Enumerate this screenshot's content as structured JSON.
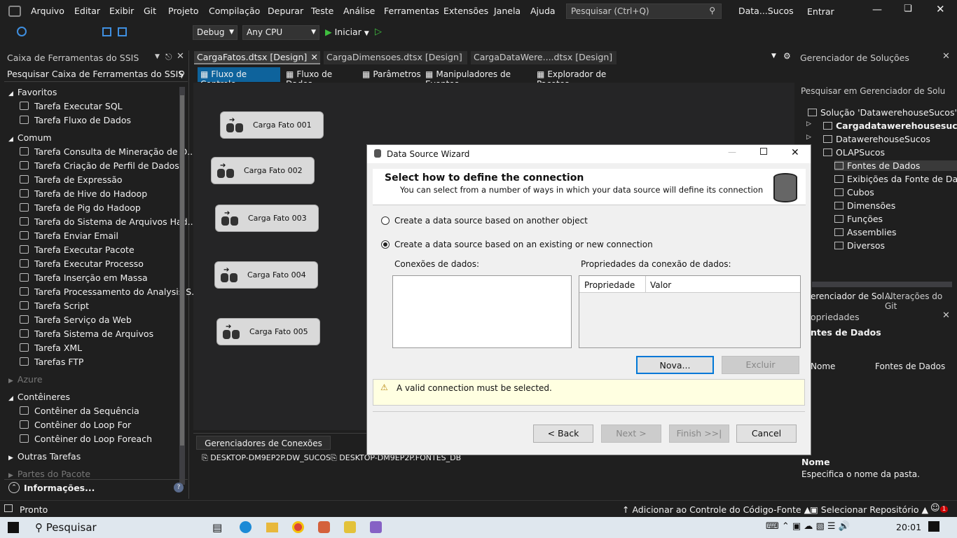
{
  "menu": {
    "items": [
      "Arquivo",
      "Editar",
      "Exibir",
      "Git",
      "Projeto",
      "Compilação",
      "Depurar",
      "Teste",
      "Análise",
      "Ferramentas",
      "Extensões",
      "Janela",
      "Ajuda"
    ],
    "search_placeholder": "Pesquisar (Ctrl+Q)",
    "solution_name": "Data...Sucos",
    "signin": "Entrar"
  },
  "toolbar": {
    "config": "Debug",
    "platform": "Any CPU",
    "start": "Iniciar"
  },
  "toolbox": {
    "title": "Caixa de Ferramentas do SSIS",
    "search_placeholder": "Pesquisar Caixa de Ferramentas do SSIS",
    "groups": {
      "favoritos": "Favoritos",
      "comum": "Comum",
      "azure": "Azure",
      "conteineres": "Contêineres",
      "outras": "Outras Tarefas",
      "partes": "Partes do Pacote"
    },
    "fav_items": [
      "Tarefa Executar SQL",
      "Tarefa Fluxo de Dados"
    ],
    "common_items": [
      "Tarefa Consulta de Mineração de D...",
      "Tarefa Criação de Perfil de Dados",
      "Tarefa de Expressão",
      "Tarefa de Hive do Hadoop",
      "Tarefa de Pig do Hadoop",
      "Tarefa do Sistema de Arquivos Had...",
      "Tarefa Enviar Email",
      "Tarefa Executar Pacote",
      "Tarefa Executar Processo",
      "Tarefa Inserção em Massa",
      "Tarefa Processamento do Analysis S...",
      "Tarefa Script",
      "Tarefa Serviço da Web",
      "Tarefa Sistema de Arquivos",
      "Tarefa XML",
      "Tarefas FTP"
    ],
    "container_items": [
      "Contêiner da Sequência",
      "Contêiner do Loop For",
      "Contêiner do Loop Foreach"
    ],
    "info": "Informações..."
  },
  "tabs": [
    {
      "label": "CargaFatos.dtsx [Design]"
    },
    {
      "label": "CargaDimensoes.dtsx [Design]"
    },
    {
      "label": "CargaDataWere....dtsx [Design]"
    }
  ],
  "designer_tabs": [
    "Fluxo de Controle",
    "Fluxo de Dados",
    "Parâmetros",
    "Manipuladores de Eventos",
    "Explorador de Pacotes"
  ],
  "tasks": [
    "Carga Fato 001",
    "Carga Fato 002",
    "Carga Fato 003",
    "Carga Fato 004",
    "Carga Fato 005"
  ],
  "connections": {
    "title": "Gerenciadores de Conexões",
    "items": [
      "DESKTOP-DM9EP2P.DW_SUCOS",
      "DESKTOP-DM9EP2P.FONTES_DB"
    ]
  },
  "wizard": {
    "title": "Data Source Wizard",
    "heading": "Select how to define the connection",
    "subheading": "You can select from a number of ways in which your data source will define its connection",
    "radio1": "Create a data source based on another object",
    "radio2": "Create a data source based on an existing or new connection",
    "conn_label": "Conexões de dados:",
    "props_label": "Propriedades da conexão de dados:",
    "col_prop": "Propriedade",
    "col_val": "Valor",
    "new_btn": "Nova...",
    "delete_btn": "Excluir",
    "warning": "A valid connection must be selected.",
    "back": "< Back",
    "next": "Next >",
    "finish": "Finish >>|",
    "cancel": "Cancel"
  },
  "solution": {
    "title": "Gerenciador de Soluções",
    "search": "Pesquisar em Gerenciador de Solu",
    "items": [
      "Solução 'DatawerehouseSucos' (3 d",
      "Cargadatawerehousesucos",
      "DatawerehouseSucos",
      "OLAPSucos",
      "Fontes de Dados",
      "Exibições da Fonte de Dados",
      "Cubos",
      "Dimensões",
      "Funções",
      "Assemblies",
      "Diversos"
    ],
    "tab1": "erenciador de Sol...",
    "tab2": "Alterações do Git"
  },
  "properties": {
    "title": "opriedades",
    "object": "ntes de Dados",
    "row_name": "Nome",
    "row_value": "Fontes de Dados",
    "desc_title": "Nome",
    "desc": "Especifica o nome da pasta."
  },
  "status": {
    "ready": "Pronto",
    "source_control": "Adicionar ao Controle do Código-Fonte",
    "repo": "Selecionar Repositório",
    "notif": "1"
  },
  "taskbar": {
    "search": "Pesquisar",
    "time": "20:01"
  }
}
